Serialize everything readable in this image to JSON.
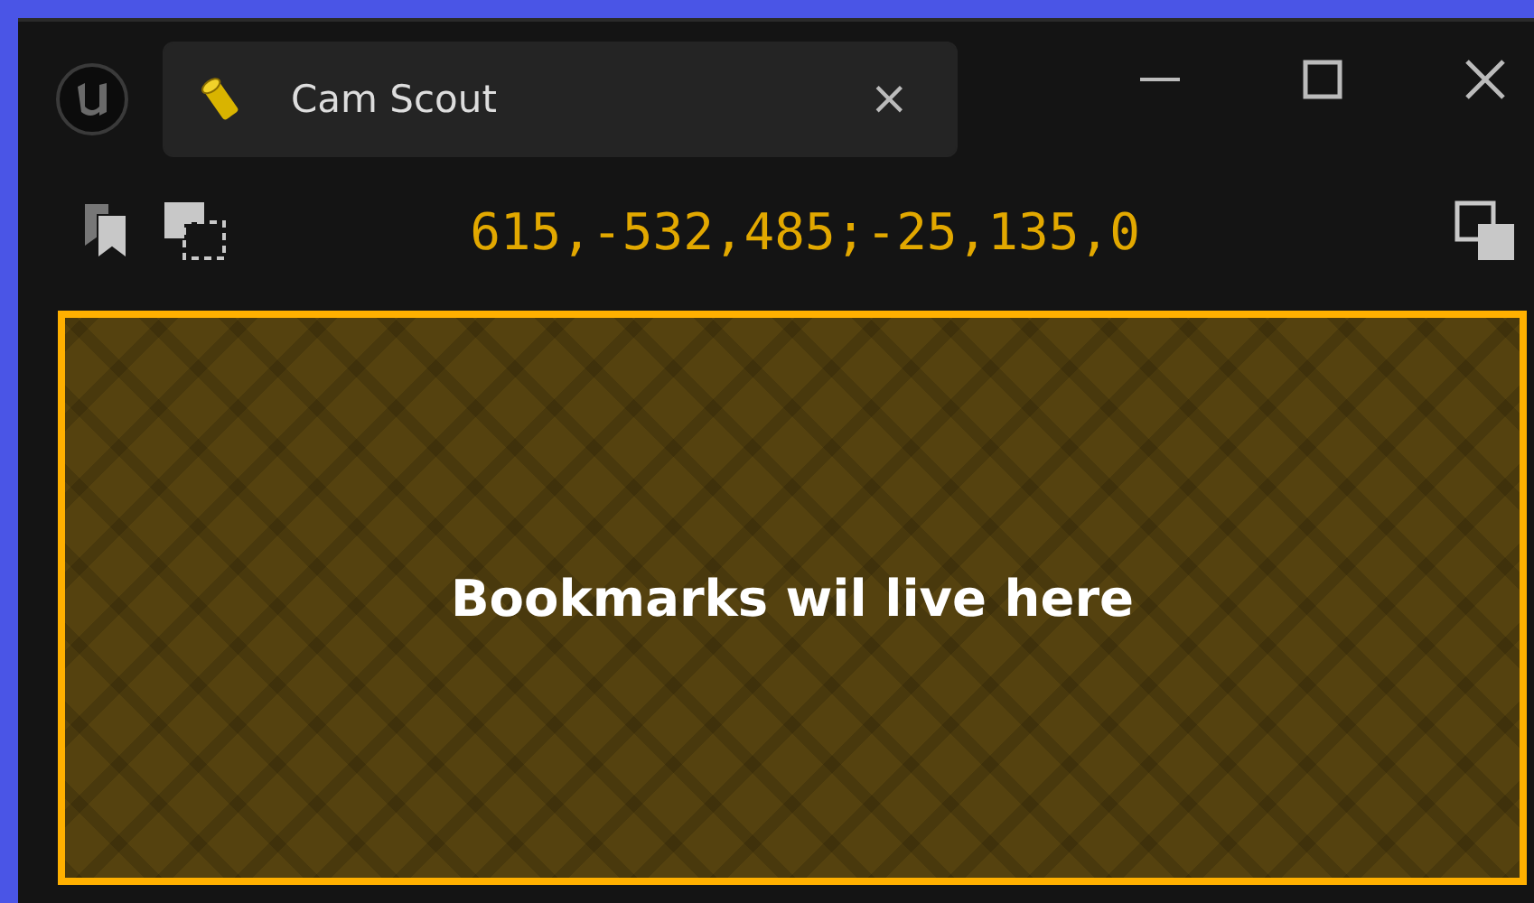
{
  "tabs": [
    {
      "label": "Cam Scout",
      "selected": true,
      "close": "×"
    }
  ],
  "toolbar": {
    "coordinates": "615,-532,485;-25,135,0"
  },
  "panel": {
    "message": "Bookmarks wil live here"
  }
}
